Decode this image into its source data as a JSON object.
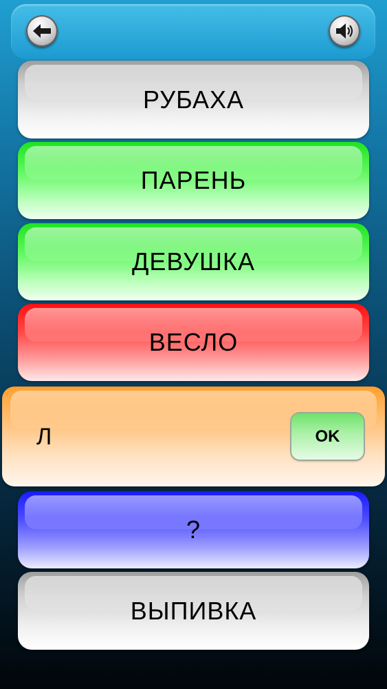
{
  "icons": {
    "back": "arrow-left-icon",
    "sound": "speaker-icon"
  },
  "words": [
    {
      "label": "РУБАХА",
      "state": "neutral",
      "color": "#d9d9d9"
    },
    {
      "label": "ПАРЕНЬ",
      "state": "correct",
      "color": "#3ff03f"
    },
    {
      "label": "ДЕВУШКА",
      "state": "correct",
      "color": "#3ff03f"
    },
    {
      "label": "ВЕСЛО",
      "state": "wrong",
      "color": "#ff3030"
    },
    {
      "label": "?",
      "state": "hidden",
      "color": "#3a3aff"
    },
    {
      "label": "ВЫПИВКА",
      "state": "neutral",
      "color": "#d9d9d9"
    }
  ],
  "answer_input": {
    "value": "Л",
    "panel_color": "#ffb060"
  },
  "ok_button": {
    "label": "OK",
    "color": "#8fea8a"
  }
}
